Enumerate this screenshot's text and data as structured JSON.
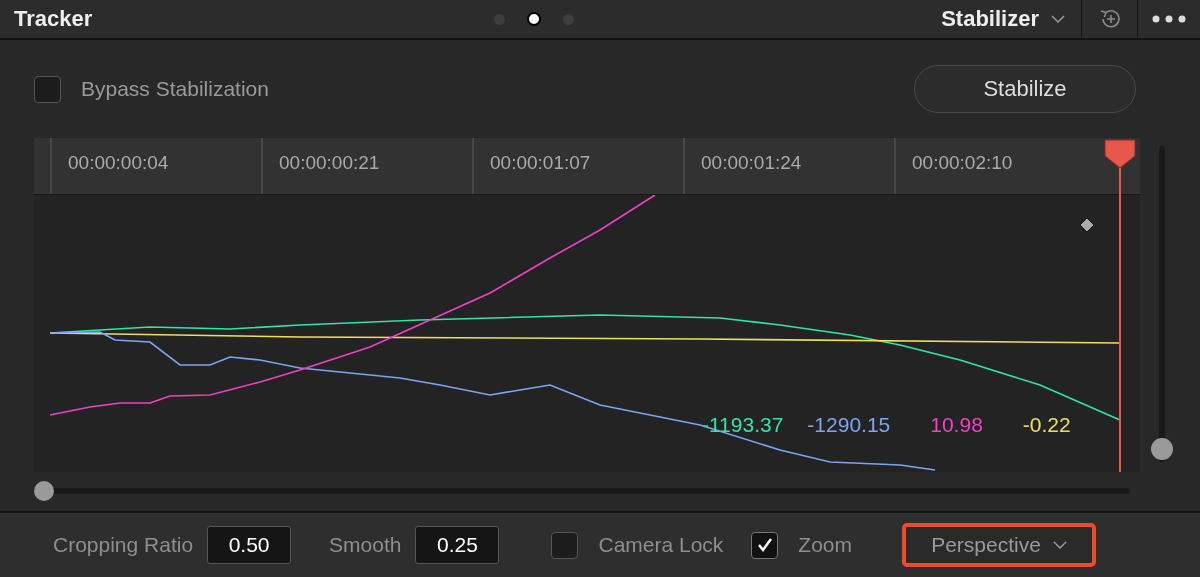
{
  "header": {
    "title": "Tracker",
    "pager": [
      {
        "selected": false
      },
      {
        "selected": true
      },
      {
        "selected": false
      }
    ],
    "mode": "Stabilizer"
  },
  "bypass": {
    "label": "Bypass Stabilization",
    "checked": false
  },
  "stabilize_button": "Stabilize",
  "timeline": {
    "timecodes": [
      "00:00:00:04",
      "00:00:00:21",
      "00:00:01:07",
      "00:00:01:24",
      "00:00:02:10"
    ],
    "readings": [
      {
        "text": "-1193.37",
        "color": "#2ee6a6"
      },
      {
        "text": "-1290.15",
        "color": "#7aa5f5"
      },
      {
        "text": "10.98",
        "color": "#f040c8"
      },
      {
        "text": "-0.22",
        "color": "#ece05a"
      }
    ],
    "scrubber": {
      "level": 0
    },
    "zoom_slider": {
      "level": 0
    }
  },
  "controls": {
    "cropping_ratio": {
      "label": "Cropping Ratio",
      "value": "0.50"
    },
    "smooth": {
      "label": "Smooth",
      "value": "0.25"
    },
    "camera_lock": {
      "label": "Camera Lock",
      "checked": false
    },
    "zoom": {
      "label": "Zoom",
      "checked": true
    },
    "mode_dropdown": {
      "value": "Perspective",
      "highlighted": true
    }
  }
}
